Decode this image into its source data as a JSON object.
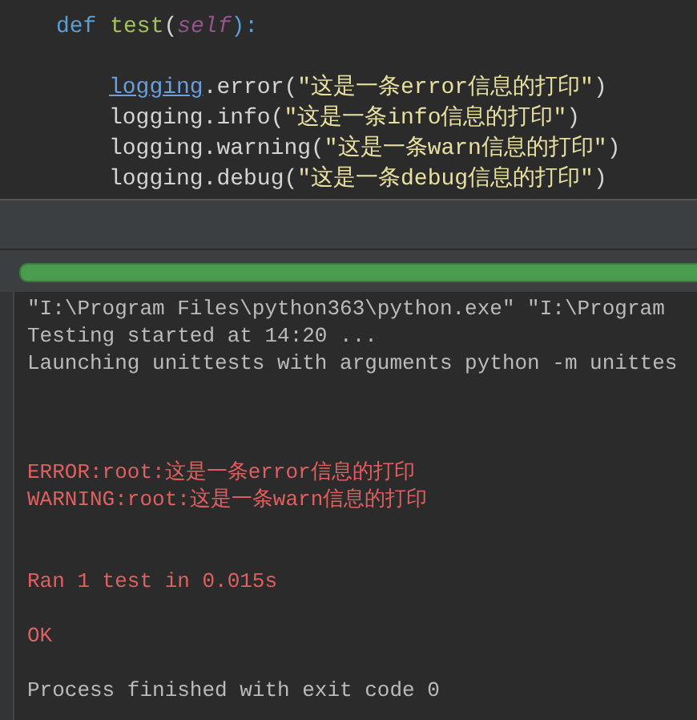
{
  "editor": {
    "lines": [
      {
        "kind": "code",
        "segments": [
          {
            "text": "def ",
            "kind": "keyword"
          },
          {
            "text": "test",
            "kind": "function"
          },
          {
            "text": "(",
            "kind": "plain"
          },
          {
            "text": "self",
            "kind": "param"
          },
          {
            "text": "):",
            "kind": "keyword"
          }
        ],
        "children": [
          {
            "kind": "blank"
          },
          {
            "kind": "code",
            "segments": [
              {
                "text": "logging",
                "kind": "module"
              },
              {
                "text": ".error(",
                "kind": "plain"
              },
              {
                "text": "\"这是一条error信息的打印\"",
                "kind": "string"
              },
              {
                "text": ")",
                "kind": "plain"
              }
            ]
          },
          {
            "kind": "code",
            "segments": [
              {
                "text": "logging.info(",
                "kind": "plain"
              },
              {
                "text": "\"这是一条info信息的打印\"",
                "kind": "string"
              },
              {
                "text": ")",
                "kind": "plain"
              }
            ]
          },
          {
            "kind": "code",
            "segments": [
              {
                "text": "logging.warning(",
                "kind": "plain"
              },
              {
                "text": "\"这是一条warn信息的打印\"",
                "kind": "string"
              },
              {
                "text": ")",
                "kind": "plain"
              }
            ]
          },
          {
            "kind": "code",
            "segments": [
              {
                "text": "logging.debug(",
                "kind": "plain"
              },
              {
                "text": "\"这是一条debug信息的打印\"",
                "kind": "string"
              },
              {
                "text": ")",
                "kind": "plain"
              }
            ]
          }
        ]
      }
    ]
  },
  "progress": {
    "level": 1
  },
  "console": {
    "lines": [
      {
        "kind": "stdout",
        "text": "\"I:\\Program Files\\python363\\python.exe\" \"I:\\Program "
      },
      {
        "kind": "stdout",
        "text": "Testing started at 14:20 ..."
      },
      {
        "kind": "stdout",
        "text": "Launching unittests with arguments python -m unittes"
      },
      {
        "kind": "blank"
      },
      {
        "kind": "blank"
      },
      {
        "kind": "blank"
      },
      {
        "kind": "stderr",
        "text": "ERROR:root:这是一条error信息的打印"
      },
      {
        "kind": "stderr",
        "text": "WARNING:root:这是一条warn信息的打印"
      },
      {
        "kind": "blank"
      },
      {
        "kind": "blank"
      },
      {
        "kind": "stderr",
        "text": "Ran 1 test in 0.015s"
      },
      {
        "kind": "blank"
      },
      {
        "kind": "stderr",
        "text": "OK"
      },
      {
        "kind": "blank"
      },
      {
        "kind": "stdout",
        "text": "Process finished with exit code 0"
      }
    ]
  }
}
